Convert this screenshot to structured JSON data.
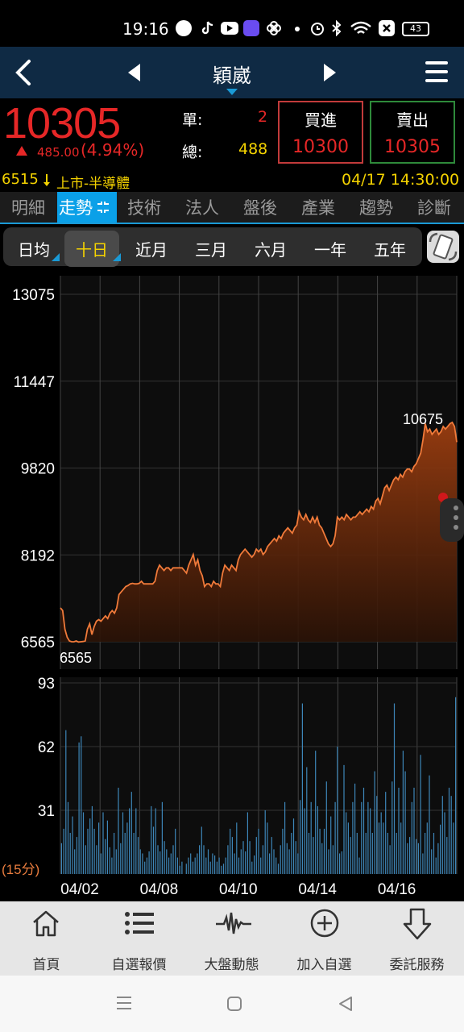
{
  "status_bar": {
    "time": "19:16",
    "battery": "43",
    "icons": [
      "line-icon",
      "tiktok-icon",
      "youtube-icon",
      "weather-icon",
      "pinwheel-icon",
      "dot-icon",
      "alarm-icon",
      "bluetooth-icon",
      "wifi-icon",
      "close-box-icon",
      "battery-icon"
    ]
  },
  "header": {
    "title": "穎崴",
    "back_icon": "back-chevron-icon",
    "prev_icon": "prev-triangle-icon",
    "next_icon": "next-triangle-icon",
    "menu_icon": "hamburger-menu-icon"
  },
  "quote": {
    "price": "10305",
    "change": "485.00",
    "change_pct": "(4.94%)",
    "single_label": "單:",
    "single_value": "2",
    "total_label": "總:",
    "total_value": "488",
    "buy_label": "買進",
    "buy_value": "10300",
    "sell_label": "賣出",
    "sell_value": "10305",
    "code": "6515",
    "market": "上市-半導體",
    "datetime": "04/17 14:30:00",
    "up_color": "#e62727",
    "accent_yellow": "#f5d300"
  },
  "tabs": [
    "明細",
    "走勢",
    "技術",
    "法人",
    "盤後",
    "產業",
    "趨勢",
    "診斷"
  ],
  "active_tab": "走勢",
  "periods": [
    "日均",
    "十日",
    "近月",
    "三月",
    "六月",
    "一年",
    "五年"
  ],
  "active_period": "十日",
  "chart_data": {
    "type": "area",
    "price_axis_ticks": [
      13075,
      11447,
      9820,
      8192,
      6565
    ],
    "ylim": [
      6565,
      13075
    ],
    "max_label": "10675",
    "min_label": "6565",
    "x_tick_labels": [
      "04/02",
      "04/08",
      "04/10",
      "04/14",
      "04/16"
    ],
    "days": 10,
    "price_series": [
      7200,
      7150,
      6800,
      6650,
      6580,
      6565,
      6565,
      6580,
      6560,
      6565,
      6570,
      6580,
      6800,
      6900,
      6700,
      6850,
      6950,
      6980,
      6950,
      7000,
      7050,
      7000,
      7100,
      7150,
      7100,
      7200,
      7450,
      7500,
      7550,
      7600,
      7620,
      7650,
      7660,
      7650,
      7650,
      7660,
      7700,
      7650,
      7650,
      7650,
      7650,
      7650,
      7700,
      7900,
      8000,
      7950,
      7900,
      7950,
      7950,
      7900,
      7950,
      7950,
      7950,
      7950,
      7950,
      7900,
      7850,
      8000,
      8100,
      8200,
      8000,
      8100,
      7900,
      7800,
      7600,
      7650,
      7650,
      7600,
      7700,
      7650,
      7650,
      7600,
      7850,
      8000,
      7950,
      7900,
      8000,
      7950,
      7900,
      8100,
      8200,
      8250,
      8300,
      8250,
      8200,
      8150,
      8200,
      8300,
      8250,
      8300,
      8200,
      8250,
      8350,
      8400,
      8450,
      8500,
      8450,
      8550,
      8500,
      8600,
      8650,
      8700,
      8650,
      8600,
      8700,
      8750,
      9000,
      8900,
      8850,
      8950,
      8850,
      8800,
      8900,
      8800,
      8900,
      8750,
      8700,
      8600,
      8500,
      8400,
      8350,
      8400,
      8550,
      8900,
      8850,
      8900,
      8850,
      8950,
      8900,
      8850,
      8900,
      8900,
      8950,
      9000,
      8950,
      9000,
      9050,
      9000,
      9100,
      9050,
      9200,
      9250,
      9150,
      9300,
      9450,
      9500,
      9400,
      9500,
      9600,
      9650,
      9600,
      9700,
      9650,
      9750,
      9800,
      9800,
      9750,
      9850,
      9900,
      10000,
      10100,
      10350,
      10650,
      10500,
      10550,
      10450,
      10500,
      10550,
      10450,
      10500,
      10600,
      10550,
      10600,
      10650,
      10675,
      10600,
      10305
    ],
    "volume_axis_ticks": [
      93,
      62,
      31
    ],
    "volume_ylim": [
      0,
      93
    ],
    "volume_unit": "(15分)",
    "volume_series": [
      15,
      22,
      70,
      35,
      20,
      28,
      12,
      18,
      64,
      67,
      30,
      14,
      22,
      27,
      33,
      22,
      14,
      25,
      10,
      30,
      17,
      26,
      13,
      8,
      20,
      12,
      42,
      15,
      30,
      20,
      25,
      32,
      40,
      20,
      32,
      18,
      12,
      10,
      6,
      8,
      11,
      33,
      23,
      32,
      14,
      11,
      35,
      16,
      12,
      8,
      10,
      14,
      22,
      8,
      4,
      6,
      0,
      5,
      8,
      10,
      6,
      8,
      10,
      14,
      23,
      14,
      8,
      12,
      6,
      10,
      9,
      6,
      8,
      4,
      5,
      8,
      14,
      22,
      18,
      10,
      25,
      8,
      12,
      16,
      11,
      30,
      16,
      6,
      9,
      18,
      22,
      8,
      14,
      31,
      25,
      10,
      18,
      12,
      8,
      5,
      14,
      22,
      35,
      15,
      12,
      20,
      27,
      16,
      10,
      36,
      83,
      32,
      52,
      20,
      35,
      18,
      60,
      33,
      22,
      15,
      22,
      45,
      12,
      28,
      14,
      35,
      62,
      10,
      11,
      53,
      30,
      25,
      18,
      35,
      44,
      20,
      8,
      35,
      42,
      20,
      35,
      32,
      20,
      50,
      38,
      25,
      30,
      25,
      40,
      20,
      14,
      45,
      83,
      20,
      42,
      25,
      60,
      50,
      15,
      18,
      35,
      42,
      17,
      15,
      58,
      10,
      20,
      25,
      48,
      12,
      20,
      8,
      15,
      24,
      38,
      30,
      18,
      42,
      38,
      25,
      86
    ]
  },
  "bottom_nav": [
    {
      "label": "首頁",
      "icon": "home-icon"
    },
    {
      "label": "自選報價",
      "icon": "list-icon"
    },
    {
      "label": "大盤動態",
      "icon": "pulse-icon"
    },
    {
      "label": "加入自選",
      "icon": "add-circle-icon"
    },
    {
      "label": "委託服務",
      "icon": "down-arrow-icon"
    }
  ],
  "system_nav": [
    "recents-icon",
    "home-square-icon",
    "back-triangle-icon"
  ]
}
